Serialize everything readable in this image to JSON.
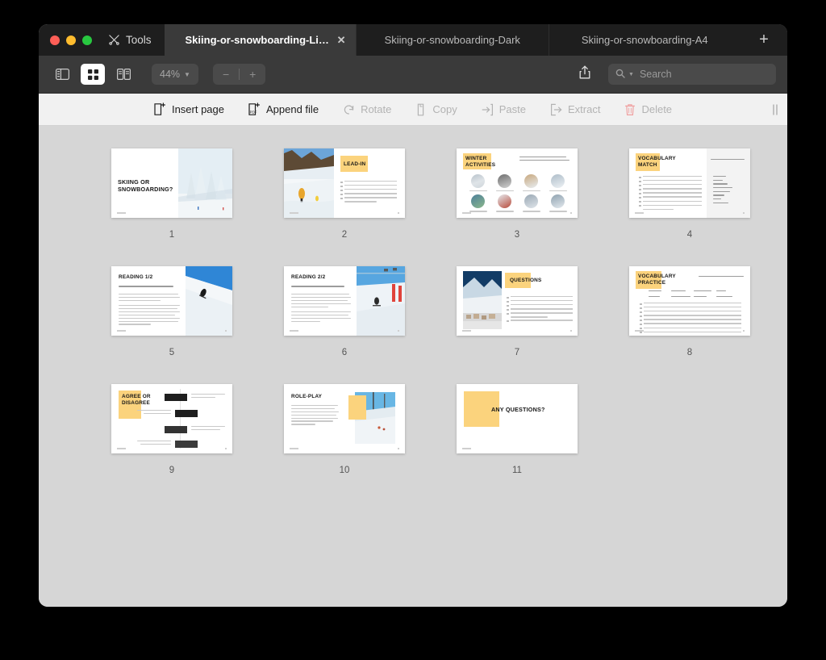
{
  "window": {
    "traffic_lights": [
      "close",
      "minimize",
      "maximize"
    ],
    "tools_label": "Tools"
  },
  "tabs": [
    {
      "label": "Skiing-or-snowboarding-Light",
      "active": true
    },
    {
      "label": "Skiing-or-snowboarding-Dark",
      "active": false
    },
    {
      "label": "Skiing-or-snowboarding-A4",
      "active": false
    }
  ],
  "new_tab_label": "+",
  "toolbar": {
    "view_sidebar_icon": "sidebar-view-icon",
    "view_grid_icon": "grid-view-icon",
    "view_split_icon": "split-view-icon",
    "zoom_level": "44%",
    "zoom_out_label": "−",
    "zoom_in_label": "+",
    "share_icon": "share-icon",
    "search_placeholder": "Search",
    "search_value": ""
  },
  "page_tools": [
    {
      "label": "Insert page",
      "icon": "insert-page-icon",
      "enabled": true
    },
    {
      "label": "Append file",
      "icon": "append-file-icon",
      "enabled": true
    },
    {
      "label": "Rotate",
      "icon": "rotate-icon",
      "enabled": false
    },
    {
      "label": "Copy",
      "icon": "copy-icon",
      "enabled": false
    },
    {
      "label": "Paste",
      "icon": "paste-icon",
      "enabled": false
    },
    {
      "label": "Extract",
      "icon": "extract-icon",
      "enabled": false
    },
    {
      "label": "Delete",
      "icon": "trash-icon",
      "enabled": false
    }
  ],
  "accent_colors": {
    "highlight_yellow": "#fbd37d",
    "window_chrome_dark": "#3a3a3a",
    "tabbar_dark": "#1e1e1e",
    "canvas_grey": "#d6d6d6",
    "subtoolbar_grey": "#f1f1f1",
    "delete_red": "#f0a0a0"
  },
  "pages": [
    {
      "number": "1",
      "title": "SKIING OR SNOWBOARDING?",
      "layout": "title-photo-right"
    },
    {
      "number": "2",
      "title": "LEAD-IN",
      "layout": "photo-left-questions"
    },
    {
      "number": "3",
      "title": "WINTER ACTIVITIES",
      "layout": "activity-grid"
    },
    {
      "number": "4",
      "title": "VOCABULARY MATCH",
      "layout": "match-two-column"
    },
    {
      "number": "5",
      "title": "READING 1/2",
      "layout": "text-photo-right"
    },
    {
      "number": "6",
      "title": "READING 2/2",
      "layout": "text-photo-right"
    },
    {
      "number": "7",
      "title": "QUESTIONS",
      "layout": "photo-left-questions"
    },
    {
      "number": "8",
      "title": "VOCABULARY PRACTICE",
      "layout": "fill-in-blanks"
    },
    {
      "number": "9",
      "title": "AGREE OR DISAGREE",
      "layout": "statement-zigzag"
    },
    {
      "number": "10",
      "title": "ROLE-PLAY",
      "layout": "text-photo-right"
    },
    {
      "number": "11",
      "title": "ANY QUESTIONS?",
      "layout": "closing"
    }
  ],
  "page_subtexts": {
    "p3_prompt_line1": "Can you name these winter activities?",
    "p3_prompt_line2": "Which ones do you think are the most exciting?",
    "p4_prompt": "Match the words and definitions.",
    "p5_sub": "Skiing or Snowboarding: Which is Right for You?",
    "p6_sub": "Skiing or Snowboarding: Which is Right for You?",
    "p8_prompt": "Fill in the blanks with the missing words."
  }
}
